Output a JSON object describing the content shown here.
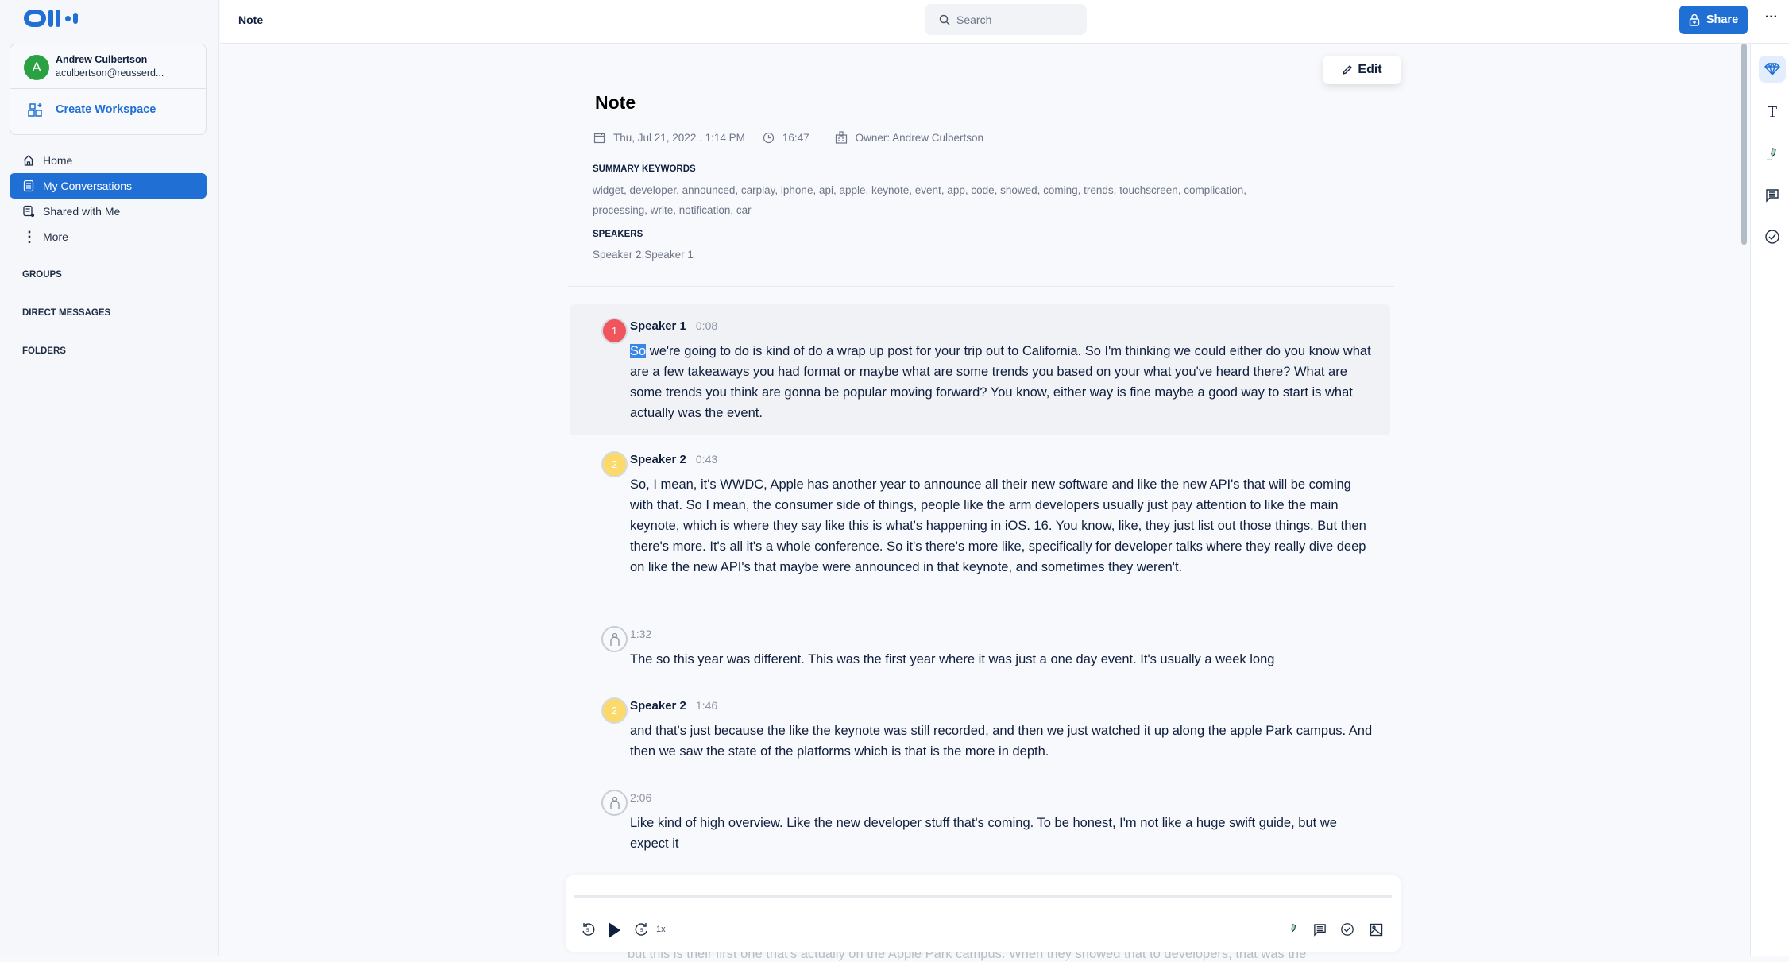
{
  "app": {
    "logo": "Otter"
  },
  "account": {
    "name": "Andrew Culbertson",
    "email": "aculbertson@reusserd...",
    "initial": "A",
    "create_workspace": "Create Workspace"
  },
  "nav": [
    {
      "label": "Home"
    },
    {
      "label": "My Conversations",
      "active": true
    },
    {
      "label": "Shared with Me"
    },
    {
      "label": "More"
    }
  ],
  "sections": {
    "groups": "GROUPS",
    "direct_messages": "DIRECT MESSAGES",
    "folders": "FOLDERS"
  },
  "topbar": {
    "title": "Note",
    "search_placeholder": "Search",
    "share": "Share",
    "more": "···"
  },
  "note": {
    "edit": "Edit",
    "title": "Note",
    "date": "Thu, Jul 21, 2022 . 1:14 PM",
    "duration": "16:47",
    "owner": "Owner: Andrew Culbertson",
    "keywords_heading": "SUMMARY KEYWORDS",
    "keywords_line1": "widget, developer, announced, carplay, iphone, api, apple, keynote, event, app, code, showed, coming, trends, touchscreen, complication,",
    "keywords_line2": "processing, write, notification, car",
    "speakers_heading": "SPEAKERS",
    "speakers": "Speaker 2,Speaker 1"
  },
  "transcript": [
    {
      "speaker": "Speaker 1",
      "badge": "1",
      "color": "#f0545c",
      "time": "0:08",
      "selected": "So",
      "text": " we're going to do is kind of do a wrap up post for your trip out to California. So I'm thinking we could either do you know what are a few takeaways you had format or maybe what are some trends you based on your what you've heard there? What are some trends you think are gonna be popular moving forward? You know, either way is fine maybe a good way to start is what actually was the event."
    },
    {
      "speaker": "Speaker 2",
      "badge": "2",
      "color": "#fbd96a",
      "time": "0:43",
      "text": "So, I mean, it's WWDC, Apple has another year to announce all their new software and like the new API's that will be coming with that. So I mean, the consumer side of things, people like the arm developers usually just pay attention to like the main keynote, which is where they say like this is what's happening in iOS. 16. You know, like, they just list out those things. But then there's more. It's all it's a whole conference. So it's there's more like, specifically for developer talks where they really dive deep on like the new API's that maybe were announced in that keynote, and sometimes they weren't."
    },
    {
      "speaker": "",
      "badge": "",
      "time": "1:32",
      "text": "The so this year was different. This was the first year where it was just a one day event. It's usually a week long"
    },
    {
      "speaker": "Speaker 2",
      "badge": "2",
      "color": "#fbd96a",
      "time": "1:46",
      "text": "and that's just because the like the keynote was still recorded, and then we just watched it up along the apple Park campus. And then we saw the state of the platforms which is that is the more in depth."
    },
    {
      "speaker": "",
      "badge": "",
      "time": "2:06",
      "text": "Like kind of high overview. Like the new developer stuff that's coming. To be honest, I'm not like a huge swift guide, but we expect it"
    }
  ],
  "behind_text": "but this is their first one that's actually on the Apple Park campus. When they showed that to developers, that was the",
  "player": {
    "speed": "1x",
    "progress": 0
  },
  "colors": {
    "accent": "#1f6fd4"
  }
}
